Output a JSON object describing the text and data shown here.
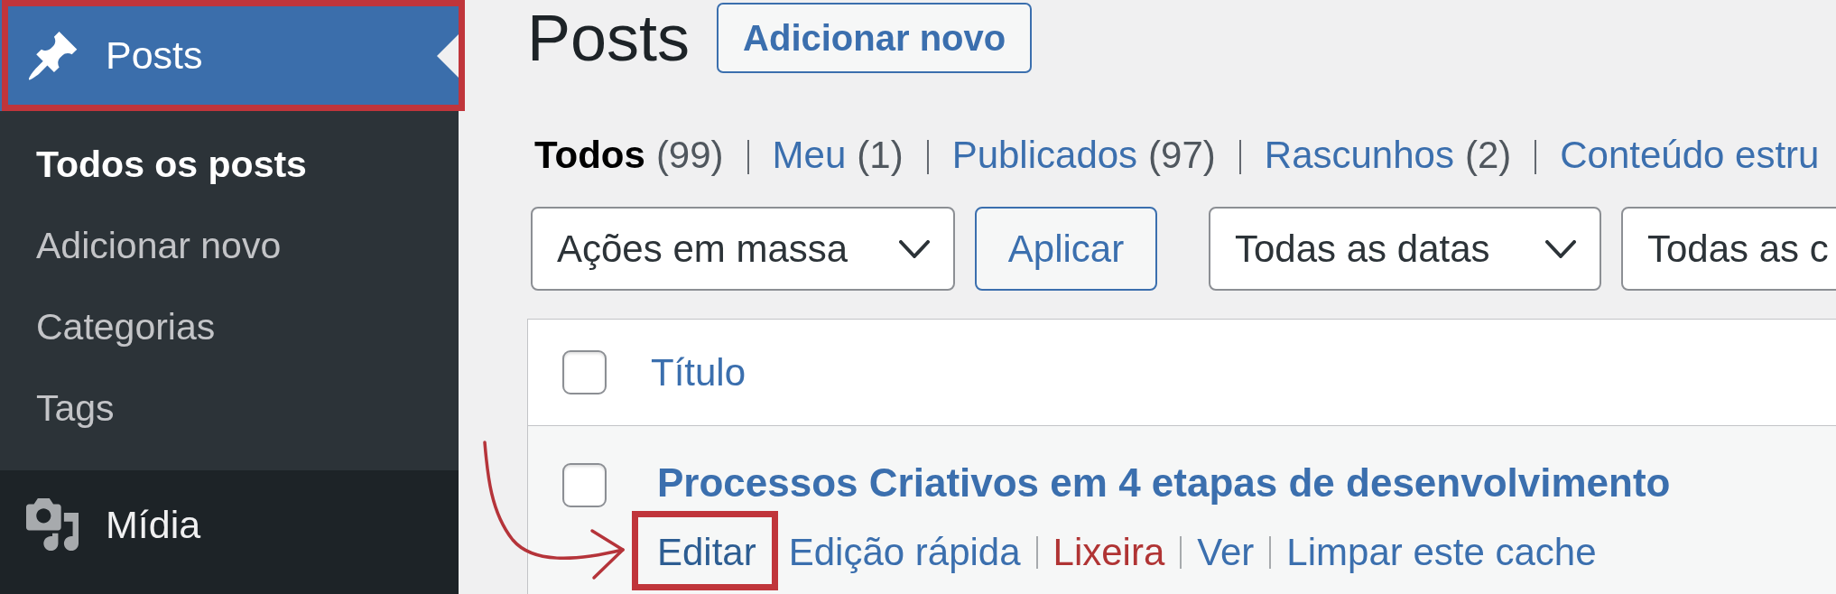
{
  "sidebar": {
    "menu": [
      {
        "label": "Posts",
        "current": true,
        "highlighted": true,
        "children": [
          {
            "label": "Todos os posts",
            "selected": true
          },
          {
            "label": "Adicionar novo",
            "selected": false
          },
          {
            "label": "Categorias",
            "selected": false
          },
          {
            "label": "Tags",
            "selected": false
          }
        ]
      },
      {
        "label": "Mídia",
        "current": false,
        "highlighted": false
      }
    ]
  },
  "header": {
    "title": "Posts",
    "add_button": "Adicionar novo"
  },
  "filters": [
    {
      "label": "Todos",
      "count": "(99)",
      "selected": true
    },
    {
      "label": "Meu",
      "count": "(1)",
      "selected": false
    },
    {
      "label": "Publicados",
      "count": "(97)",
      "selected": false
    },
    {
      "label": "Rascunhos",
      "count": "(2)",
      "selected": false
    },
    {
      "label": "Conteúdo estru",
      "selected": false
    }
  ],
  "toolbar": [
    {
      "kind": "select",
      "value": "Ações em massa"
    },
    {
      "kind": "button",
      "label": "Aplicar"
    },
    {
      "kind": "select",
      "value": "Todas as datas"
    },
    {
      "kind": "select",
      "value": "Todas as c"
    }
  ],
  "table": {
    "columns": [
      {
        "label": "Título"
      }
    ],
    "select_all_checked": false,
    "rows": [
      {
        "checked": false,
        "title": "Processos Criativos em 4 etapas de desenvolvimento",
        "actions": [
          {
            "kind": "link",
            "label": "Editar",
            "highlighted": true
          },
          {
            "kind": "link",
            "label": "Edição rápida",
            "highlighted": false
          },
          {
            "kind": "delete",
            "label": "Lixeira",
            "highlighted": false
          },
          {
            "kind": "link",
            "label": "Ver",
            "highlighted": false
          },
          {
            "kind": "link",
            "label": "Limpar este cache",
            "highlighted": false
          }
        ]
      }
    ]
  }
}
